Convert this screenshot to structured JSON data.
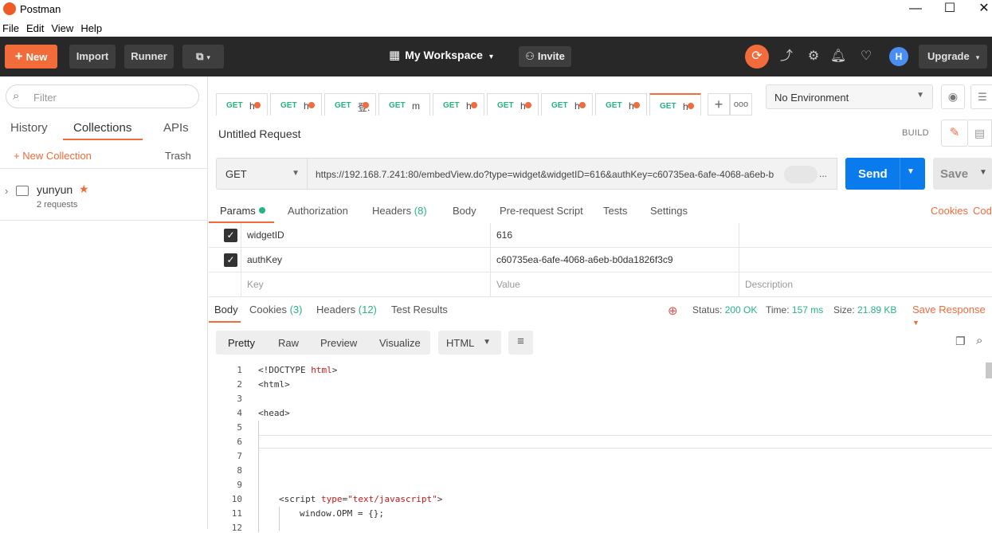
{
  "window": {
    "title": "Postman",
    "min": "—",
    "max": "☐",
    "close": "✕"
  },
  "menu": [
    "File",
    "Edit",
    "View",
    "Help"
  ],
  "header": {
    "new_label": "New",
    "new_icon": "+",
    "import_label": "Import",
    "runner_label": "Runner",
    "builder_icon": "⧉",
    "workspace_label": "My Workspace",
    "workspace_icon": "▦",
    "invite_label": "Invite",
    "invite_icon": "⚇",
    "upgrade_label": "Upgrade",
    "accent": "#f26b3a"
  },
  "sidebar": {
    "filter_placeholder": "Filter",
    "tabs": [
      "History",
      "Collections",
      "APIs"
    ],
    "active_tab": "Collections",
    "new_collection": "+ New Collection",
    "trash": "Trash",
    "collection": {
      "name": "yunyun",
      "requests": "2 requests",
      "star": "★"
    }
  },
  "request_tabs": [
    {
      "method": "GET",
      "name": "h",
      "dot": true
    },
    {
      "method": "GET",
      "name": "h",
      "dot": true
    },
    {
      "method": "GET",
      "name": "登.",
      "dot": true
    },
    {
      "method": "GET",
      "name": "m",
      "dot": false
    },
    {
      "method": "GET",
      "name": "h",
      "dot": true
    },
    {
      "method": "GET",
      "name": "h",
      "dot": true
    },
    {
      "method": "GET",
      "name": "h",
      "dot": true
    },
    {
      "method": "GET",
      "name": "h",
      "dot": true
    },
    {
      "method": "GET",
      "name": "h",
      "dot": true,
      "active": true
    }
  ],
  "tab_plus": "+",
  "tab_more": "ooo",
  "environment": {
    "value": "No Environment"
  },
  "request": {
    "title": "Untitled Request",
    "build_label": "BUILD",
    "method": "GET",
    "url": "https://192.168.7.241:80/embedView.do?type=widget&widgetID=616&authKey=c60735ea-6afe-4068-a6eb-b",
    "url_more": "...",
    "send_label": "Send",
    "save_label": "Save"
  },
  "param_tabs": [
    {
      "label": "Params",
      "count": "",
      "dot": true
    },
    {
      "label": "Authorization",
      "count": ""
    },
    {
      "label": "Headers",
      "count": "(8)"
    },
    {
      "label": "Body",
      "count": ""
    },
    {
      "label": "Pre-request Script",
      "count": ""
    },
    {
      "label": "Tests",
      "count": ""
    },
    {
      "label": "Settings",
      "count": ""
    }
  ],
  "param_links": {
    "cookies": "Cookies",
    "code": "Cod"
  },
  "params": [
    {
      "checked": true,
      "key": "widgetID",
      "value": "616",
      "description": ""
    },
    {
      "checked": true,
      "key": "authKey",
      "value": "c60735ea-6afe-4068-a6eb-b0da1826f3c9",
      "description": ""
    }
  ],
  "params_placeholder": {
    "key": "Key",
    "value": "Value",
    "description": "Description"
  },
  "response": {
    "tabs": [
      {
        "label": "Body",
        "count": ""
      },
      {
        "label": "Cookies",
        "count": "(3)"
      },
      {
        "label": "Headers",
        "count": "(12)"
      },
      {
        "label": "Test Results",
        "count": ""
      }
    ],
    "status_label": "Status:",
    "status": "200 OK",
    "time_label": "Time:",
    "time": "157 ms",
    "size_label": "Size:",
    "size": "21.89 KB",
    "save_response": "Save Response",
    "views": [
      "Pretty",
      "Raw",
      "Preview",
      "Visualize"
    ],
    "format": "HTML"
  },
  "code_lines": [
    {
      "n": "1",
      "text": "<!DOCTYPE html>"
    },
    {
      "n": "2",
      "text": "<html>"
    },
    {
      "n": "3",
      "text": ""
    },
    {
      "n": "4",
      "text": "<head>"
    },
    {
      "n": "5",
      "text": ""
    },
    {
      "n": "6",
      "text": ""
    },
    {
      "n": "7",
      "text": ""
    },
    {
      "n": "8",
      "text": ""
    },
    {
      "n": "9",
      "text": ""
    },
    {
      "n": "10",
      "text": "    <script type=\"text/javascript\">"
    },
    {
      "n": "11",
      "text": "        window.OPM = {};"
    },
    {
      "n": "12",
      "text": ""
    }
  ]
}
